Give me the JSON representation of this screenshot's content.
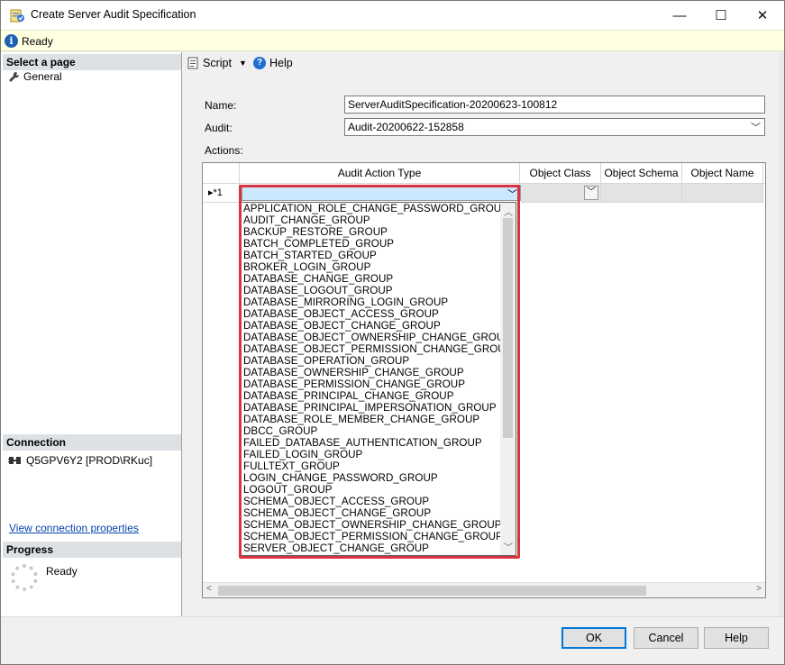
{
  "window": {
    "title": "Create Server Audit Specification",
    "minimize": "—",
    "maximize": "☐",
    "close": "✕"
  },
  "status": {
    "text": "Ready"
  },
  "left": {
    "select_page_header": "Select a page",
    "pages": [
      "General"
    ],
    "connection_header": "Connection",
    "connection_value": "Q5GPV6Y2 [PROD\\RKuc]",
    "connection_link": "View connection properties",
    "progress_header": "Progress",
    "progress_value": "Ready"
  },
  "toolbar": {
    "script_label": "Script",
    "help_label": "Help"
  },
  "form": {
    "name_label": "Name:",
    "name_value": "ServerAuditSpecification-20200623-100812",
    "audit_label": "Audit:",
    "audit_value": "Audit-20200622-152858",
    "actions_label": "Actions:"
  },
  "grid": {
    "columns": [
      "Audit Action Type",
      "Object Class",
      "Object Schema",
      "Object Name"
    ],
    "row_label": "▸*1"
  },
  "dropdown_items": [
    "APPLICATION_ROLE_CHANGE_PASSWORD_GROUP",
    "AUDIT_CHANGE_GROUP",
    "BACKUP_RESTORE_GROUP",
    "BATCH_COMPLETED_GROUP",
    "BATCH_STARTED_GROUP",
    "BROKER_LOGIN_GROUP",
    "DATABASE_CHANGE_GROUP",
    "DATABASE_LOGOUT_GROUP",
    "DATABASE_MIRRORING_LOGIN_GROUP",
    "DATABASE_OBJECT_ACCESS_GROUP",
    "DATABASE_OBJECT_CHANGE_GROUP",
    "DATABASE_OBJECT_OWNERSHIP_CHANGE_GROUP",
    "DATABASE_OBJECT_PERMISSION_CHANGE_GROUP",
    "DATABASE_OPERATION_GROUP",
    "DATABASE_OWNERSHIP_CHANGE_GROUP",
    "DATABASE_PERMISSION_CHANGE_GROUP",
    "DATABASE_PRINCIPAL_CHANGE_GROUP",
    "DATABASE_PRINCIPAL_IMPERSONATION_GROUP",
    "DATABASE_ROLE_MEMBER_CHANGE_GROUP",
    "DBCC_GROUP",
    "FAILED_DATABASE_AUTHENTICATION_GROUP",
    "FAILED_LOGIN_GROUP",
    "FULLTEXT_GROUP",
    "LOGIN_CHANGE_PASSWORD_GROUP",
    "LOGOUT_GROUP",
    "SCHEMA_OBJECT_ACCESS_GROUP",
    "SCHEMA_OBJECT_CHANGE_GROUP",
    "SCHEMA_OBJECT_OWNERSHIP_CHANGE_GROUP",
    "SCHEMA_OBJECT_PERMISSION_CHANGE_GROUP",
    "SERVER_OBJECT_CHANGE_GROUP"
  ],
  "buttons": {
    "ok": "OK",
    "cancel": "Cancel",
    "help": "Help"
  },
  "colors": {
    "highlight": "#d9333f",
    "status_bg": "#ffffe1",
    "selection": "#cce8ff",
    "link": "#0645ad"
  }
}
